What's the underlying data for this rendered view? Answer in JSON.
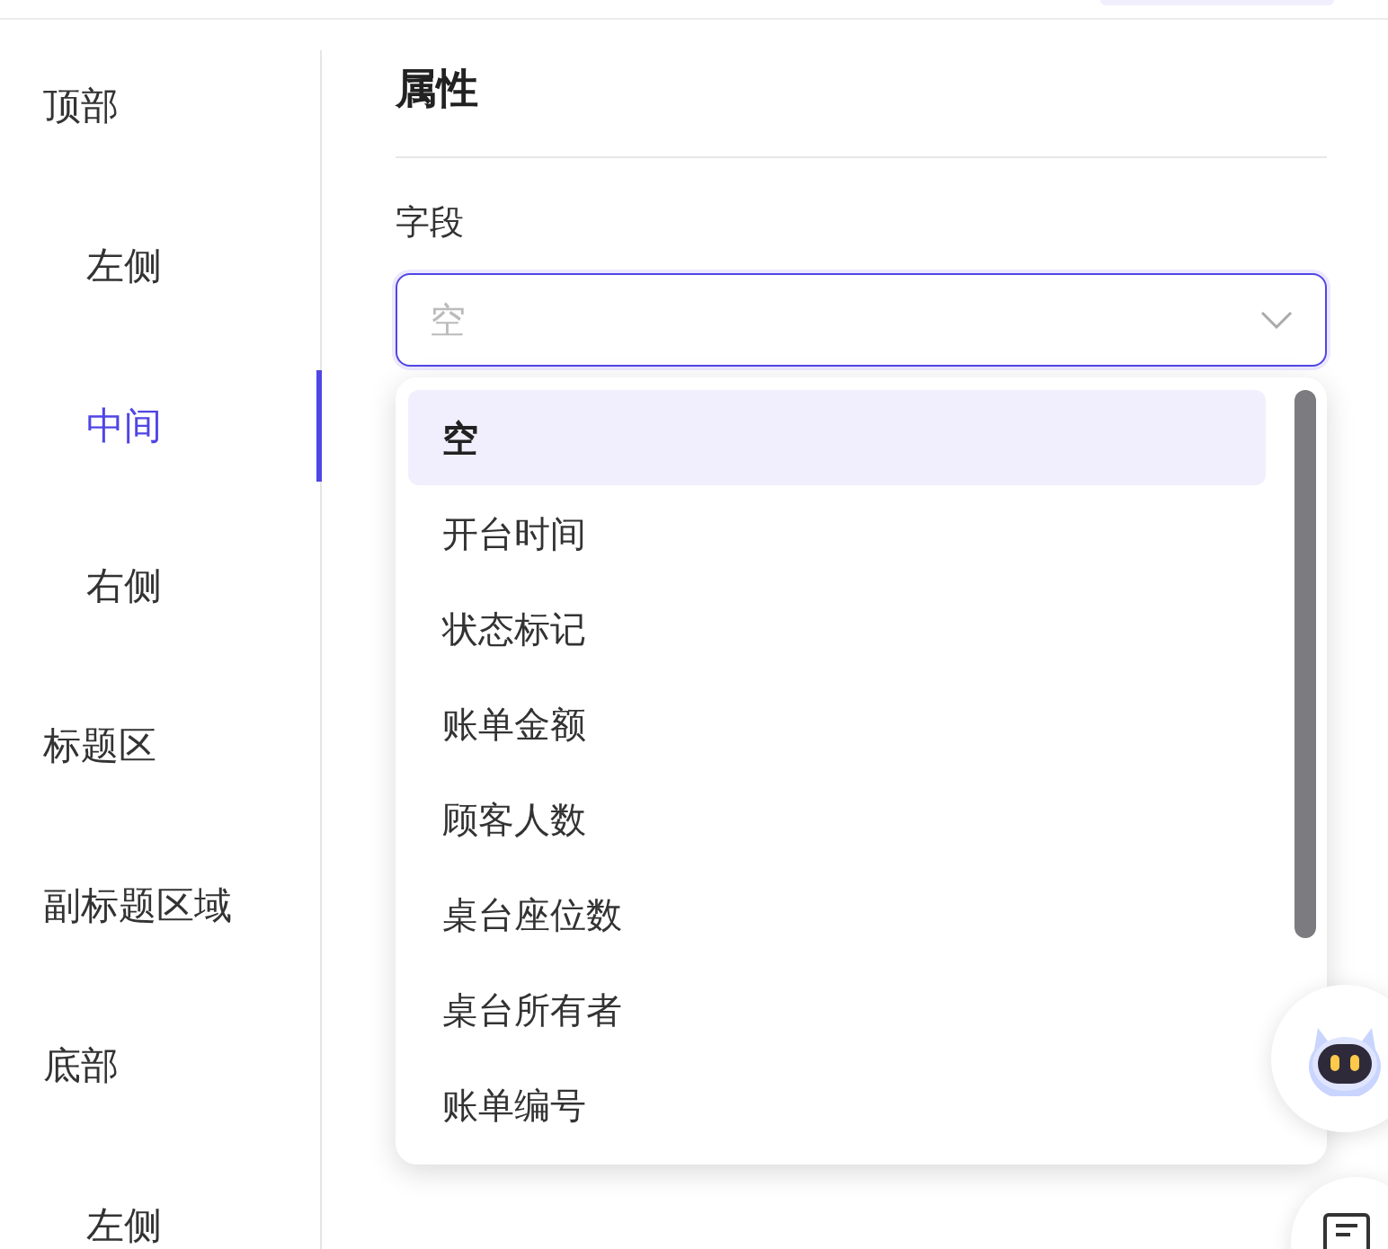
{
  "sidebar": {
    "items": [
      {
        "label": "顶部",
        "selected": false,
        "children": [
          {
            "label": "左侧",
            "selected": false
          },
          {
            "label": "中间",
            "selected": true
          },
          {
            "label": "右侧",
            "selected": false
          }
        ]
      },
      {
        "label": "标题区",
        "selected": false
      },
      {
        "label": "副标题区域",
        "selected": false
      },
      {
        "label": "底部",
        "selected": false,
        "children": [
          {
            "label": "左侧",
            "selected": false
          }
        ]
      }
    ]
  },
  "panel": {
    "title": "属性",
    "field": {
      "label": "字段",
      "placeholder": "空",
      "expanded": true,
      "options": [
        {
          "label": "空",
          "selected": true
        },
        {
          "label": "开台时间",
          "selected": false
        },
        {
          "label": "状态标记",
          "selected": false
        },
        {
          "label": "账单金额",
          "selected": false
        },
        {
          "label": "顾客人数",
          "selected": false
        },
        {
          "label": "桌台座位数",
          "selected": false
        },
        {
          "label": "桌台所有者",
          "selected": false
        },
        {
          "label": "账单编号",
          "selected": false
        }
      ]
    }
  }
}
